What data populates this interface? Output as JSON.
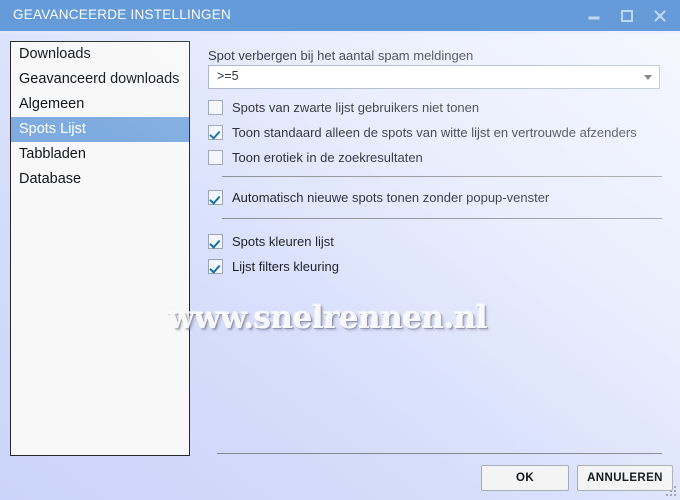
{
  "window": {
    "title": "GEAVANCEERDE INSTELLINGEN",
    "accent_color": "#649bd8",
    "selection_color": "#7facE0",
    "background_color": "#dfe7fb",
    "controls": {
      "minimize": "minimize-icon",
      "maximize": "maximize-icon",
      "close": "close-icon"
    }
  },
  "sidebar": {
    "selected_index": 3,
    "items": [
      {
        "label": "Downloads"
      },
      {
        "label": "Geavanceerd downloads"
      },
      {
        "label": "Algemeen"
      },
      {
        "label": "Spots Lijst"
      },
      {
        "label": "Tabbladen"
      },
      {
        "label": "Database"
      }
    ]
  },
  "main": {
    "combo": {
      "label": "Spot verbergen bij het aantal spam meldingen",
      "value": ">=5",
      "arrow_icon": "chevron-down-icon"
    },
    "group1": [
      {
        "label": "Spots van zwarte lijst gebruikers niet tonen",
        "checked": false
      },
      {
        "label": "Toon standaard alleen de spots van witte lijst en vertrouwde afzenders",
        "checked": true
      },
      {
        "label": "Toon erotiek in de zoekresultaten",
        "checked": false
      }
    ],
    "group2": [
      {
        "label": "Automatisch nieuwe spots tonen zonder popup-venster",
        "checked": true
      }
    ],
    "group3": [
      {
        "label": "Spots kleuren lijst",
        "checked": true
      },
      {
        "label": "Lijst filters kleuring",
        "checked": true
      }
    ]
  },
  "footer": {
    "ok_label": "OK",
    "cancel_label": "ANNULEREN"
  },
  "watermark": {
    "text": "www.snelrennen.nl"
  }
}
